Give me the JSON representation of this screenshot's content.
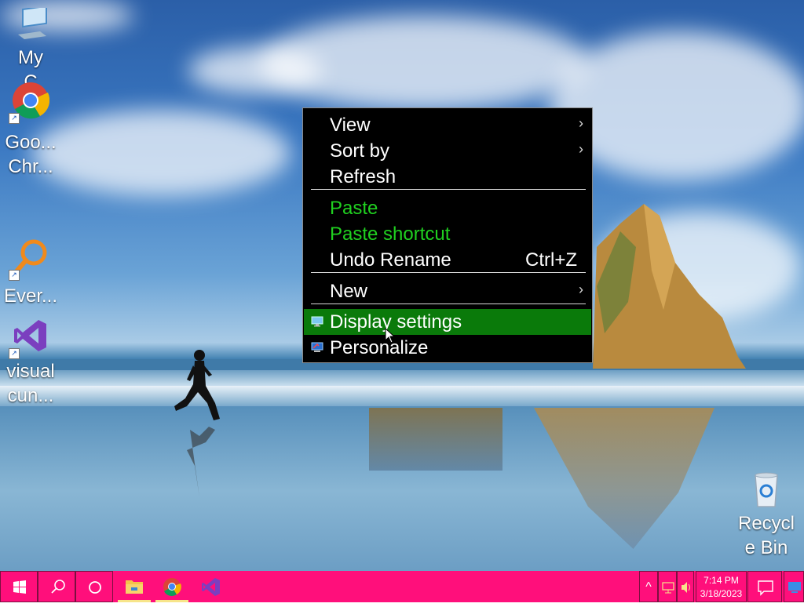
{
  "desktop": {
    "icons": [
      {
        "name": "My Computer",
        "label": "My\nC"
      },
      {
        "name": "Google Chrome",
        "label": "Goo...\nChr..."
      },
      {
        "name": "Everything",
        "label": "Ever..."
      },
      {
        "name": "visual cun",
        "label": "visual\ncun..."
      },
      {
        "name": "Recycle Bin",
        "label": "Recycl\ne Bin"
      }
    ]
  },
  "context_menu": {
    "items": [
      {
        "label": "View",
        "has_submenu": true
      },
      {
        "label": "Sort by",
        "has_submenu": true
      },
      {
        "label": "Refresh"
      },
      {
        "label": "Paste",
        "color": "#20d020"
      },
      {
        "label": "Paste shortcut",
        "color": "#20d020"
      },
      {
        "label": "Undo Rename",
        "shortcut": "Ctrl+Z"
      },
      {
        "label": "New",
        "has_submenu": true
      },
      {
        "label": "Display settings",
        "icon": "display-icon",
        "highlighted": true
      },
      {
        "label": "Personalize",
        "icon": "personalize-icon"
      }
    ],
    "submenu_arrow": "›"
  },
  "taskbar": {
    "start": "windows-start-icon",
    "search": "search-icon",
    "cortana": "cortana-icon",
    "pinned": [
      {
        "name": "File Explorer",
        "icon": "file-explorer-icon",
        "running": true
      },
      {
        "name": "Google Chrome",
        "icon": "chrome-icon",
        "running": true
      },
      {
        "name": "Visual Studio",
        "icon": "visual-studio-icon",
        "running": false
      }
    ],
    "tray": {
      "show_hidden": "^",
      "icons": [
        "network-icon",
        "volume-icon"
      ]
    },
    "clock": {
      "time": "7:14 PM",
      "date": "3/18/2023"
    },
    "notification": "action-center-icon",
    "show_desktop": "show-desktop-icon",
    "colors": {
      "taskbar": "#ff0f7b",
      "running_indicator": "#f7e58a"
    }
  }
}
